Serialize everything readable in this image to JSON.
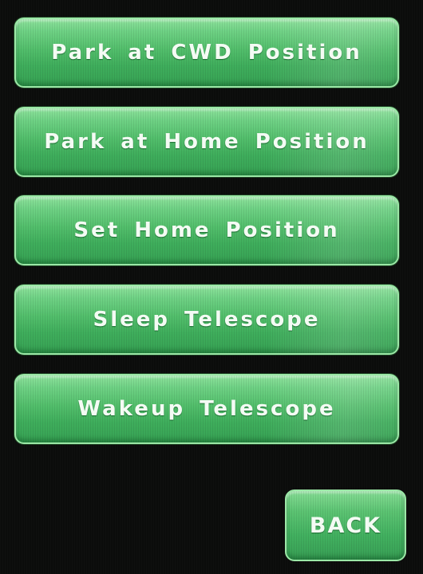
{
  "menu": {
    "buttons": [
      {
        "label": "Park at CWD Position"
      },
      {
        "label": "Park at Home Position"
      },
      {
        "label": "Set Home Position"
      },
      {
        "label": "Sleep Telescope"
      },
      {
        "label": "Wakeup Telescope"
      }
    ]
  },
  "navigation": {
    "back_label": "BACK"
  },
  "colors": {
    "button_green": "#4cb866",
    "button_border": "#9be8a6",
    "background": "#0b0c0b",
    "label_text": "#f4fbf4"
  }
}
